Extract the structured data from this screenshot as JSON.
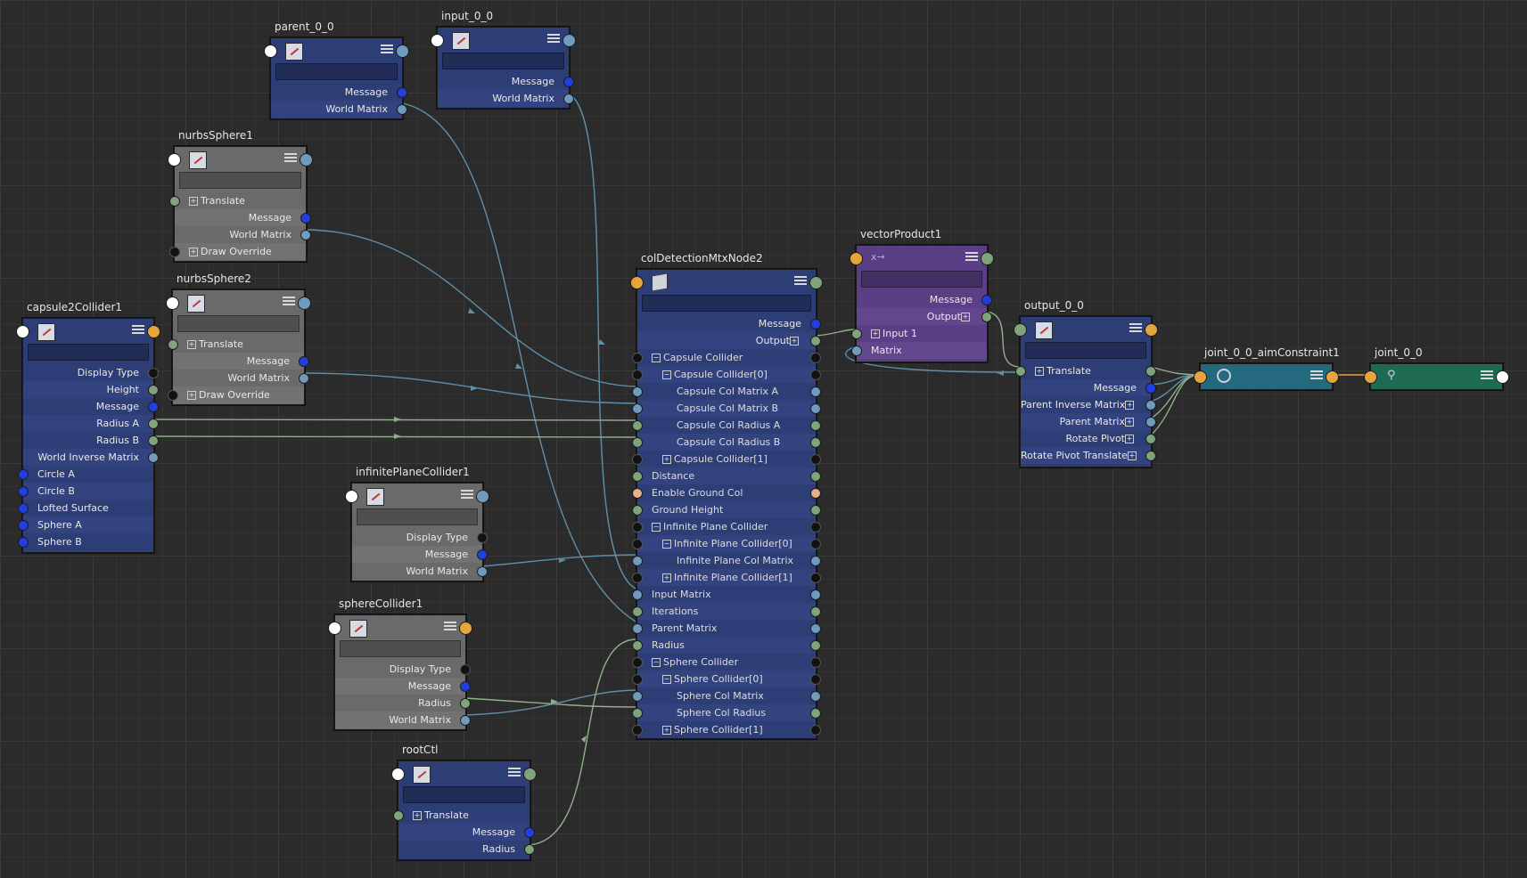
{
  "nodes": {
    "parent": {
      "title": "parent_0_0",
      "rows": [
        "Message",
        "World Matrix"
      ]
    },
    "input": {
      "title": "input_0_0",
      "rows": [
        "Message",
        "World Matrix"
      ]
    },
    "nurbs1": {
      "title": "nurbsSphere1",
      "rows": [
        "Translate",
        "Message",
        "World Matrix",
        "Draw Override"
      ]
    },
    "nurbs2": {
      "title": "nurbsSphere2",
      "rows": [
        "Translate",
        "Message",
        "World Matrix",
        "Draw Override"
      ]
    },
    "capsule": {
      "title": "capsule2Collider1",
      "rows": [
        "Display Type",
        "Height",
        "Message",
        "Radius A",
        "Radius B",
        "World Inverse Matrix",
        "Circle A",
        "Circle B",
        "Lofted Surface",
        "Sphere A",
        "Sphere B"
      ]
    },
    "infplane": {
      "title": "infinitePlaneCollider1",
      "rows": [
        "Display Type",
        "Message",
        "World Matrix"
      ]
    },
    "sphere": {
      "title": "sphereCollider1",
      "rows": [
        "Display Type",
        "Message",
        "Radius",
        "World Matrix"
      ]
    },
    "root": {
      "title": "rootCtl",
      "rows": [
        "Translate",
        "Message",
        "Radius"
      ]
    },
    "coldet": {
      "title": "colDetectionMtxNode2",
      "rows": [
        "Message",
        "Output",
        "Capsule Collider",
        "Capsule Collider[0]",
        "Capsule Col Matrix A",
        "Capsule Col Matrix B",
        "Capsule Col Radius A",
        "Capsule Col Radius B",
        "Capsule Collider[1]",
        "Distance",
        "Enable Ground Col",
        "Ground Height",
        "Infinite Plane Collider",
        "Infinite Plane Collider[0]",
        "Infinite Plane Col Matrix",
        "Infinite Plane Collider[1]",
        "Input Matrix",
        "Iterations",
        "Parent Matrix",
        "Radius",
        "Sphere Collider",
        "Sphere Collider[0]",
        "Sphere Col Matrix",
        "Sphere Col Radius",
        "Sphere Collider[1]"
      ]
    },
    "vecprod": {
      "title": "vectorProduct1",
      "rows": [
        "Message",
        "Output",
        "Input 1",
        "Matrix"
      ]
    },
    "output": {
      "title": "output_0_0",
      "rows": [
        "Translate",
        "Message",
        "Parent Inverse Matrix",
        "Parent Matrix",
        "Rotate Pivot",
        "Rotate Pivot Translate"
      ]
    },
    "aim": {
      "title": "joint_0_0_aimConstraint1"
    },
    "joint": {
      "title": "joint_0_0"
    }
  },
  "colors": {
    "transform_node": "#2d3d75",
    "shape_node": "#6a6a6a",
    "utility_node": "#5a3f86",
    "constraint_node": "#25697e",
    "joint_node": "#1f6a52",
    "wire_matrix": "#5f8fa8",
    "wire_float": "#8fb08a"
  }
}
